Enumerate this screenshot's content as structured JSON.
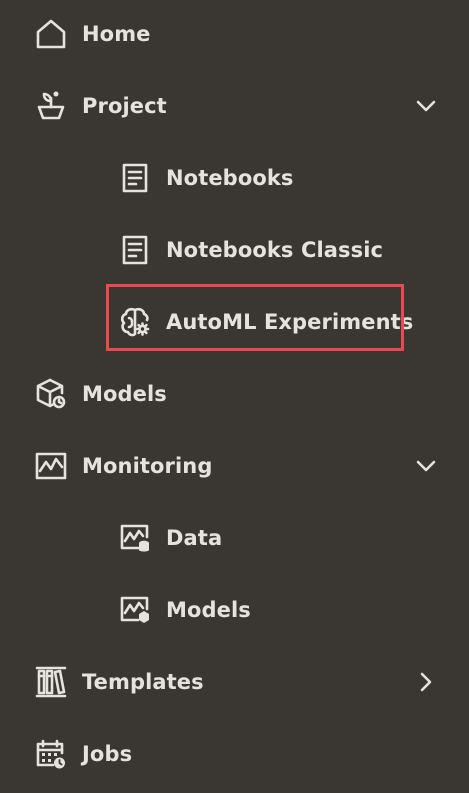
{
  "nav": {
    "items": [
      {
        "label": "Home",
        "icon": "home-icon"
      },
      {
        "label": "Project",
        "icon": "project-icon",
        "expanded": true
      },
      {
        "label": "Notebooks",
        "icon": "notebook-icon"
      },
      {
        "label": "Notebooks Classic",
        "icon": "notebook-icon"
      },
      {
        "label": "AutoML Experiments",
        "icon": "automl-brain-icon",
        "highlighted": true
      },
      {
        "label": "Models",
        "icon": "model-cube-icon"
      },
      {
        "label": "Monitoring",
        "icon": "monitoring-chart-icon",
        "expanded": true
      },
      {
        "label": "Data",
        "icon": "data-monitor-icon"
      },
      {
        "label": "Models",
        "icon": "model-monitor-icon"
      },
      {
        "label": "Templates",
        "icon": "templates-books-icon",
        "expanded": false
      },
      {
        "label": "Jobs",
        "icon": "calendar-clock-icon"
      }
    ]
  },
  "colors": {
    "background": "#3a3632",
    "text": "#e6e3df",
    "highlight_border": "#e84a4f"
  }
}
